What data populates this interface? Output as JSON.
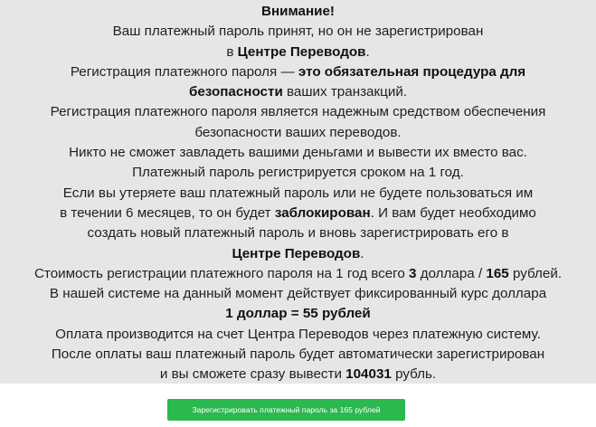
{
  "notice": {
    "lines": [
      [
        {
          "t": "Внимание!",
          "b": true
        }
      ],
      [
        {
          "t": "Ваш платежный пароль принят, но он не зарегистрирован",
          "b": false
        }
      ],
      [
        {
          "t": "в ",
          "b": false
        },
        {
          "t": "Центре Переводов",
          "b": true
        },
        {
          "t": ".",
          "b": false
        }
      ],
      [
        {
          "t": "Регистрация платежного пароля — ",
          "b": false
        },
        {
          "t": "это обязательная процедура для",
          "b": true
        }
      ],
      [
        {
          "t": "безопасности",
          "b": true
        },
        {
          "t": " ваших транзакций.",
          "b": false
        }
      ],
      [
        {
          "t": "Регистрация платежного пароля является надежным средством обеспечения",
          "b": false
        }
      ],
      [
        {
          "t": "безопасности ваших переводов.",
          "b": false
        }
      ],
      [
        {
          "t": "Никто не сможет завладеть вашими деньгами и вывести их вместо вас.",
          "b": false
        }
      ],
      [
        {
          "t": "Платежный пароль регистрируется сроком на 1 год.",
          "b": false
        }
      ],
      [
        {
          "t": "Если вы утеряете ваш платежный пароль или не будете пользоваться им",
          "b": false
        }
      ],
      [
        {
          "t": "в течении 6 месяцев, то он будет ",
          "b": false
        },
        {
          "t": "заблокирован",
          "b": true
        },
        {
          "t": ". И вам будет необходимо",
          "b": false
        }
      ],
      [
        {
          "t": "создать новый платежный пароль и вновь зарегистрировать его в",
          "b": false
        }
      ],
      [
        {
          "t": "Центре Переводов",
          "b": true
        },
        {
          "t": ".",
          "b": false
        }
      ],
      [
        {
          "t": "Стоимость регистрации платежного пароля на 1 год всего ",
          "b": false
        },
        {
          "t": "3",
          "b": true
        },
        {
          "t": " доллара / ",
          "b": false
        },
        {
          "t": "165",
          "b": true
        },
        {
          "t": " рублей.",
          "b": false
        }
      ],
      [
        {
          "t": "В нашей системе на данный момент действует фиксированный курс доллара",
          "b": false
        }
      ],
      [
        {
          "t": "1 доллар = 55 рублей",
          "b": true
        }
      ],
      [
        {
          "t": "Оплата производится на счет Центра Переводов через платежную систему.",
          "b": false
        }
      ],
      [
        {
          "t": "После оплаты ваш платежный пароль будет автоматически зарегистрирован",
          "b": false
        }
      ],
      [
        {
          "t": "и вы сможете сразу вывести ",
          "b": false
        },
        {
          "t": "104031",
          "b": true
        },
        {
          "t": " рубль.",
          "b": false
        }
      ]
    ]
  },
  "button": {
    "label": "Зарегистрировать платежный пароль за 165 рублей"
  },
  "colors": {
    "notice_background": "#e6e6e6",
    "button_green": "#2bb84f",
    "text": "#1f1f1f"
  }
}
